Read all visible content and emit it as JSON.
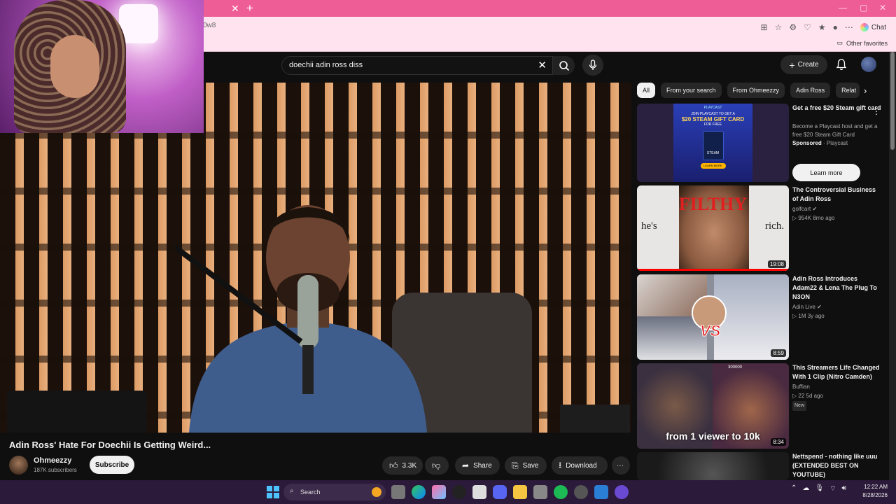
{
  "browser": {
    "url_fragment": "0w8",
    "chat_label": "Chat",
    "other_favorites_label": "Other favorites"
  },
  "youtube": {
    "search_query": "doechii adin ross diss",
    "create_label": "Create"
  },
  "video": {
    "title": "Adin Ross' Hate For Doechii Is Getting Weird...",
    "channel_name": "Ohmeezzy",
    "subscribers": "187K subscribers",
    "subscribe_label": "Subscribe",
    "likes": "3.3K",
    "share_label": "Share",
    "save_label": "Save",
    "download_label": "Download"
  },
  "chips": [
    "All",
    "From your search",
    "From Ohmeezzy",
    "Adin Ross",
    "Relat"
  ],
  "recommendations": [
    {
      "title": "Get a free $20 Steam gift card",
      "description": "Become a Playcast host and get a free $20 Steam Gift Card",
      "sponsored": "Sponsored",
      "advertiser": "· Playcast",
      "cta": "Learn more",
      "thumb_text_top": "JOIN PLAYCAST TO GET A",
      "thumb_text_main": "$20 STEAM GIFT CARD",
      "thumb_text_sub": "FOR FREE",
      "thumb_logo": "STEAM",
      "thumb_btn": "LEARN MORE",
      "thumb_brand": "PLAYCAST"
    },
    {
      "title": "The Controversial Business of Adin Ross",
      "channel": "golfcart",
      "meta": "▷ 954K  8mo ago",
      "duration": "19:08",
      "thumb_text_main": "FILTHY",
      "thumb_text_left": "he's",
      "thumb_text_right": "rich."
    },
    {
      "title": "Adin Ross Introduces Adam22 & Lena The Plug To N3ON",
      "channel": "Adin Live",
      "meta": "▷ 1M  3y ago",
      "duration": "8:59",
      "thumb_text_main": "VS"
    },
    {
      "title": "This Streamers Life Changed With 1 Clip (Nitro Camden)",
      "channel": "Buffian",
      "meta": "▷ 22  5d ago",
      "badge": "New",
      "duration": "8:34",
      "thumb_text_main": "from 1 viewer to 10k",
      "thumb_text_counter": "300000"
    },
    {
      "title": "Nettspend - nothing like uuu (EXTENDED BEST ON YOUTUBE)"
    }
  ],
  "taskbar": {
    "search_label": "Search",
    "time": "12:22 AM",
    "date": "8/28/2026"
  },
  "colors": {
    "tab_bar": "#ef5d97",
    "address_bar": "#ffe4ef",
    "yt_background": "#0f0f0f",
    "taskbar": "#2b1a3a",
    "progress_red": "#ff0000"
  }
}
